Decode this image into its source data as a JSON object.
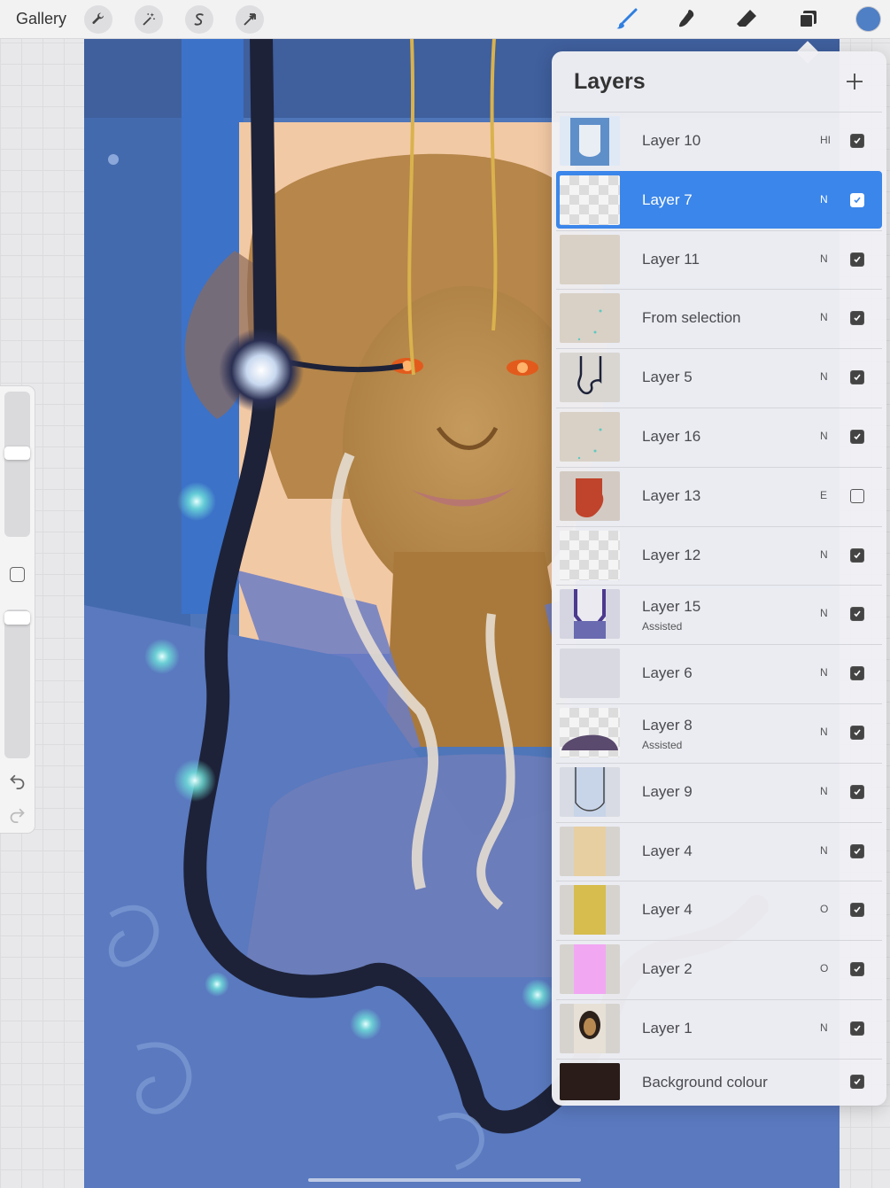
{
  "app": {
    "gallery_label": "Gallery"
  },
  "toolbar": {
    "left_tools": [
      {
        "name": "wrench-icon"
      },
      {
        "name": "magic-wand-icon"
      },
      {
        "name": "selection-icon"
      },
      {
        "name": "transform-arrow-icon"
      }
    ],
    "right_tools": [
      {
        "name": "brush-icon",
        "active": true
      },
      {
        "name": "smudge-icon"
      },
      {
        "name": "eraser-icon"
      },
      {
        "name": "layers-icon"
      }
    ],
    "current_color": "#4f7fc4"
  },
  "sidebar": {
    "brush_size_level": 0.55,
    "opacity_level": 0.93,
    "undo_icon": "undo-arrow-icon",
    "redo_icon": "redo-arrow-icon"
  },
  "layers_panel": {
    "title": "Layers",
    "add_icon": "plus-icon",
    "layers": [
      {
        "name": "Layer 10",
        "sub": "",
        "blend": "HI",
        "visible": true,
        "selected": false,
        "thumb": "blue-figure"
      },
      {
        "name": "Layer 7",
        "sub": "",
        "blend": "N",
        "visible": true,
        "selected": true,
        "thumb": "checker"
      },
      {
        "name": "Layer 11",
        "sub": "",
        "blend": "N",
        "visible": true,
        "selected": false,
        "thumb": "beige"
      },
      {
        "name": "From selection",
        "sub": "",
        "blend": "N",
        "visible": true,
        "selected": false,
        "thumb": "beige-dots"
      },
      {
        "name": "Layer 5",
        "sub": "",
        "blend": "N",
        "visible": true,
        "selected": false,
        "thumb": "cord"
      },
      {
        "name": "Layer 16",
        "sub": "",
        "blend": "N",
        "visible": true,
        "selected": false,
        "thumb": "beige-dots"
      },
      {
        "name": "Layer 13",
        "sub": "",
        "blend": "E",
        "visible": false,
        "selected": false,
        "thumb": "red-figure"
      },
      {
        "name": "Layer 12",
        "sub": "",
        "blend": "N",
        "visible": true,
        "selected": false,
        "thumb": "checker"
      },
      {
        "name": "Layer 15",
        "sub": "Assisted",
        "blend": "N",
        "visible": true,
        "selected": false,
        "thumb": "purple-collar"
      },
      {
        "name": "Layer 6",
        "sub": "",
        "blend": "N",
        "visible": true,
        "selected": false,
        "thumb": "light"
      },
      {
        "name": "Layer 8",
        "sub": "Assisted",
        "blend": "N",
        "visible": true,
        "selected": false,
        "thumb": "dark-mound"
      },
      {
        "name": "Layer 9",
        "sub": "",
        "blend": "N",
        "visible": true,
        "selected": false,
        "thumb": "blue-cloak"
      },
      {
        "name": "Layer 4",
        "sub": "",
        "blend": "N",
        "visible": true,
        "selected": false,
        "thumb": "tan"
      },
      {
        "name": "Layer 4",
        "sub": "",
        "blend": "O",
        "visible": true,
        "selected": false,
        "thumb": "yellow"
      },
      {
        "name": "Layer 2",
        "sub": "",
        "blend": "O",
        "visible": true,
        "selected": false,
        "thumb": "pink"
      },
      {
        "name": "Layer 1",
        "sub": "",
        "blend": "N",
        "visible": true,
        "selected": false,
        "thumb": "portrait"
      }
    ],
    "background": {
      "name": "Background colour",
      "visible": true,
      "color": "#2a1d19"
    }
  },
  "colors": {
    "accent": "#3b86ea",
    "canvas_blue": "#4f76b9"
  }
}
